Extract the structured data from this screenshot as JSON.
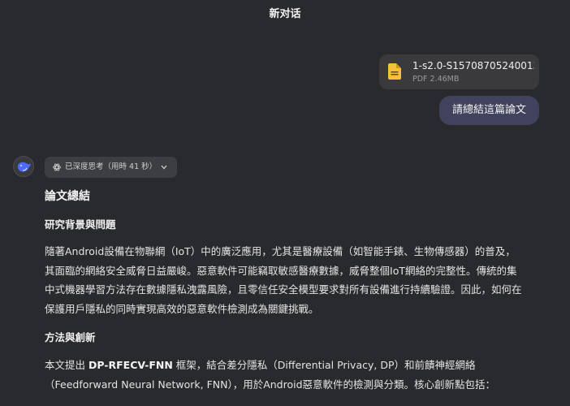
{
  "header": {
    "title": "新对话"
  },
  "attachment": {
    "file_name": "1-s2.0-S15708705240013...",
    "meta": "PDF 2.46MB",
    "icon": "document-icon",
    "icon_color": "#f5c13b"
  },
  "user_message": {
    "text": "請總結這篇論文"
  },
  "assistant": {
    "avatar_icon": "whale-icon",
    "accent": "#4d6bfe",
    "think_chip": {
      "label": "已深度思考（用時 41 秒）"
    },
    "title": "論文總結",
    "sections": [
      {
        "heading": "研究背景與問題",
        "lines": [
          "隨著Android設備在物聯網（IoT）中的廣泛應用，尤其是醫療設備（如智能手錶、生物傳感器）的普及，",
          "其面臨的網絡安全威脅日益嚴峻。惡意軟件可能竊取敏感醫療數據，威脅整個IoT網絡的完整性。傳統的集",
          "中式機器學習方法存在數據隱私洩露風險，且零信任安全模型要求對所有設備進行持續驗證。因此，如何在",
          "保護用戶隱私的同時實現高效的惡意軟件檢測成為關鍵挑戰。"
        ]
      },
      {
        "heading": "方法與創新",
        "line1_prefix": "本文提出 ",
        "line1_bold": "DP-RFECV-FNN",
        "line1_suffix": " 框架，結合差分隱私（Differential Privacy, DP）和前饋神經網絡",
        "lines_after": [
          "（Feedforward Neural Network, FNN），用於Android惡意軟件的檢測與分類。核心創新點包括："
        ]
      }
    ]
  }
}
